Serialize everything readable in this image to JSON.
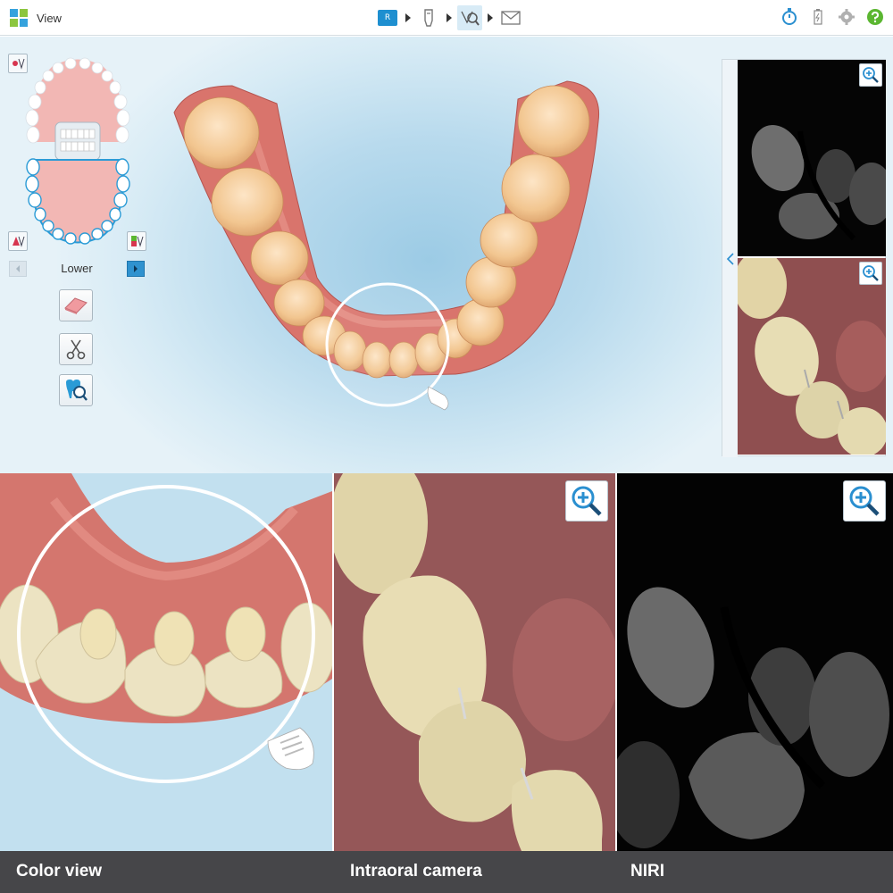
{
  "header": {
    "title": "View",
    "steps": [
      {
        "name": "rx",
        "icon": "rx-form-icon",
        "label": "R",
        "active": false
      },
      {
        "name": "scan",
        "icon": "scanner-wand-icon",
        "active": false
      },
      {
        "name": "view",
        "icon": "view-tools-icon",
        "active": true
      },
      {
        "name": "send",
        "icon": "envelope-icon",
        "active": false
      }
    ],
    "right_icons": [
      "timer-icon",
      "battery-icon",
      "gear-icon",
      "help-icon"
    ],
    "accent_color": "#1e8fd0"
  },
  "tools": {
    "jaw_label": "Lower",
    "jaw_tools": [
      "upper-jaw-toggle-icon",
      "lower-jaw-toggle-icon",
      "bite-toggle-icon"
    ],
    "actions": [
      "eraser-icon",
      "scissors-icon",
      "tooth-review-icon"
    ]
  },
  "captions": {
    "color": "Color view",
    "camera": "Intraoral camera",
    "niri": "NIRI"
  }
}
